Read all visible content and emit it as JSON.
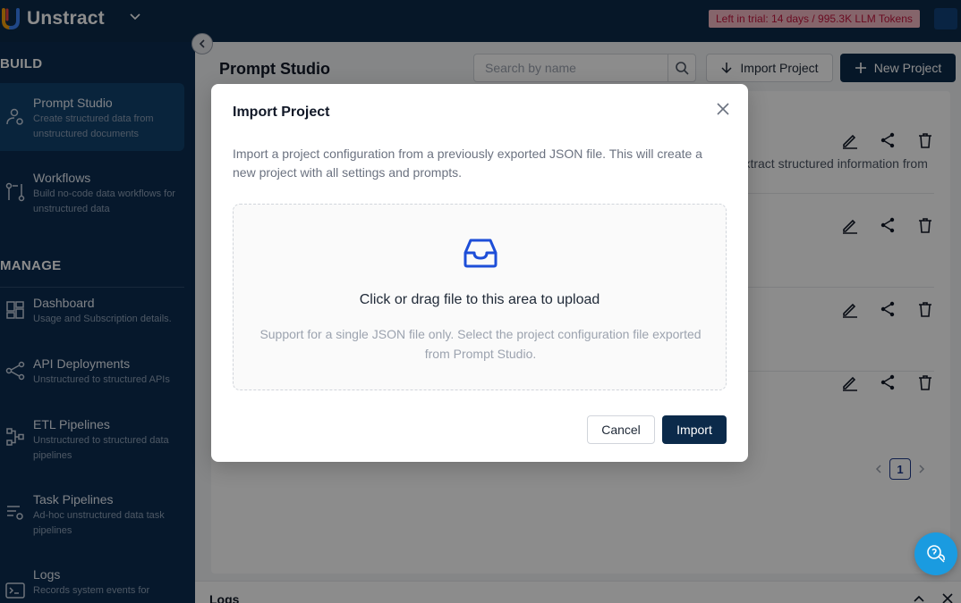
{
  "app": {
    "brand_name": "Unstract",
    "trial_badge": "Left in trial: 14 days / 995.3K LLM Tokens"
  },
  "sidebar": {
    "sections": [
      {
        "title": "BUILD"
      },
      {
        "title": "MANAGE"
      }
    ],
    "items": [
      {
        "label": "Prompt Studio",
        "description": "Create structured data from unstructured documents",
        "icon": "prompt-studio-icon",
        "active": true
      },
      {
        "label": "Workflows",
        "description": "Build no-code data workflows for unstructured data",
        "icon": "workflow-icon"
      },
      {
        "label": "Dashboard",
        "description": "Usage and Subscription details.",
        "icon": "dashboard-icon"
      },
      {
        "label": "API Deployments",
        "description": "Unstructured to structured APIs",
        "icon": "api-icon"
      },
      {
        "label": "ETL Pipelines",
        "description": "Unstructured to structured data pipelines",
        "icon": "etl-icon"
      },
      {
        "label": "Task Pipelines",
        "description": "Ad-hoc unstructured data task pipelines",
        "icon": "task-icon"
      },
      {
        "label": "Logs",
        "description": "Records system events for",
        "icon": "logs-icon"
      }
    ]
  },
  "main": {
    "page_title": "Prompt Studio",
    "search": {
      "placeholder": "Search by name",
      "value": ""
    },
    "import_label": "Import Project",
    "new_label": "New Project",
    "rows": [
      {
        "description": "e extract structured information from"
      },
      {
        "description": ""
      },
      {
        "description": ""
      },
      {
        "description": ""
      }
    ],
    "pagination": {
      "current": "1"
    },
    "logs_title": "Logs"
  },
  "modal": {
    "title": "Import Project",
    "description": "Import a project configuration from a previously exported JSON file. This will create a new project with all settings and prompts.",
    "dropzone_title": "Click or drag file to this area to upload",
    "dropzone_hint": "Support for a single JSON file only. Select the project configuration file exported from Prompt Studio.",
    "cancel_label": "Cancel",
    "import_label": "Import"
  },
  "colors": {
    "navy": "#0b2a4a",
    "sidebar": "#0c2d50",
    "accent_blue": "#1e3a8a",
    "trial_text": "#c0143c",
    "help_blue": "#1a9be0"
  }
}
